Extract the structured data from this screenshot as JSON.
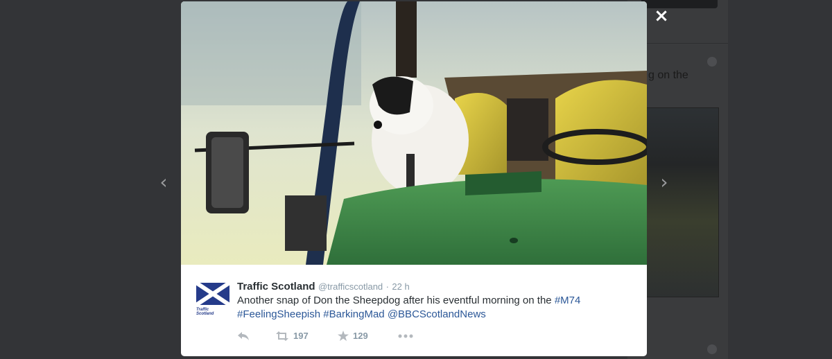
{
  "background": {
    "partial_text": "g on the"
  },
  "lightbox": {
    "close_icon": "×",
    "prev_icon": "‹",
    "next_icon": "›"
  },
  "tweet": {
    "author_name": "Traffic Scotland",
    "handle": "@trafficscotland",
    "separator": "·",
    "time": "22 h",
    "avatar_caption": "Traffic Scotland",
    "text_parts": {
      "t1": "Another snap of Don the Sheepdog after his eventful morning on the ",
      "hashtag_m74": "#M74",
      "hashtag_feeling": "#FeelingSheepish",
      "hashtag_barking": "#BarkingMad",
      "mention_bbc": "@BBCScotlandNews"
    },
    "actions": {
      "retweet_count": "197",
      "favorite_count": "129"
    }
  },
  "colors": {
    "overlay": "#333437",
    "link": "#2b5797",
    "name": "#292f33",
    "meta": "#8899a6",
    "saltire_blue": "#253b8a"
  }
}
